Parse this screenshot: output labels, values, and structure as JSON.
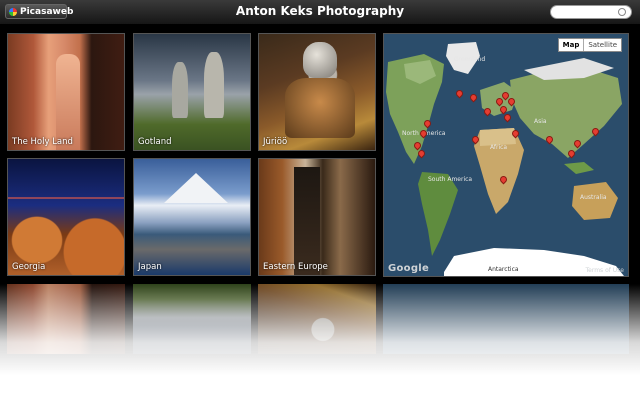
{
  "app_button": {
    "label": "Picasaweb"
  },
  "title": "Anton Keks Photography",
  "search": {
    "value": "",
    "placeholder": ""
  },
  "albums": [
    {
      "caption": "The Holy Land"
    },
    {
      "caption": "Gotland"
    },
    {
      "caption": "Jüriöö"
    },
    {
      "caption": "Georgia"
    },
    {
      "caption": "Japan"
    },
    {
      "caption": "Eastern Europe"
    }
  ],
  "map": {
    "toggle": {
      "map": "Map",
      "satellite": "Satellite"
    },
    "labels": {
      "greenland": "Greenland",
      "north_america": "North America",
      "south_america": "South America",
      "africa": "Africa",
      "asia": "Asia",
      "australia": "Australia",
      "antarctica": "Antarctica"
    },
    "google": "Google",
    "terms": "Terms of Use"
  },
  "colors": {
    "background": "#000000",
    "pin": "#e53d31",
    "ocean": "#2b4d6b"
  }
}
